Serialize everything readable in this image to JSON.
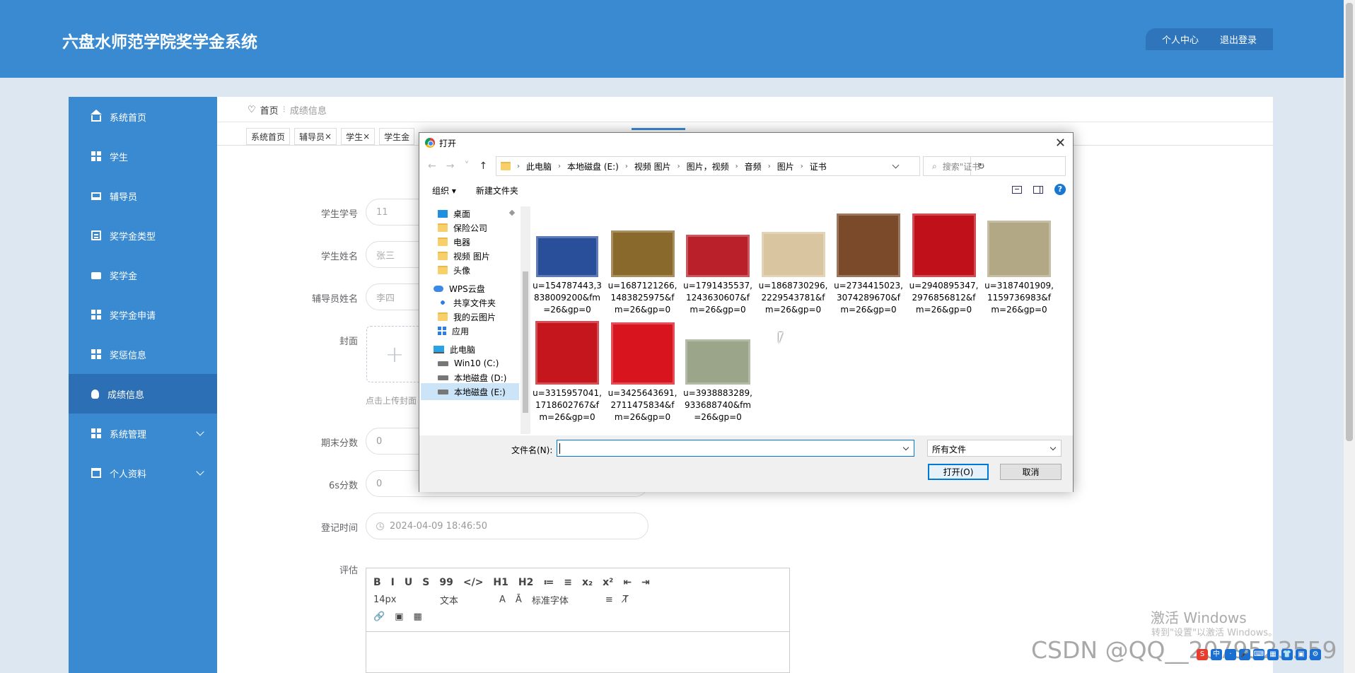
{
  "header": {
    "title": "六盘水师范学院奖学金系统",
    "profile_label": "个人中心",
    "logout_label": "退出登录"
  },
  "sidebar": {
    "items": [
      {
        "label": "系统首页",
        "icon": "home-icon"
      },
      {
        "label": "学生",
        "icon": "grid-icon"
      },
      {
        "label": "辅导员",
        "icon": "monitor-icon"
      },
      {
        "label": "奖学金类型",
        "icon": "clipboard-icon"
      },
      {
        "label": "奖学金",
        "icon": "card-icon"
      },
      {
        "label": "奖学金申请",
        "icon": "grid-icon"
      },
      {
        "label": "奖惩信息",
        "icon": "grid-icon"
      },
      {
        "label": "成绩信息",
        "icon": "bulb-icon",
        "active": true
      },
      {
        "label": "系统管理",
        "icon": "grid-icon"
      },
      {
        "label": "个人资料",
        "icon": "calendar-icon"
      }
    ]
  },
  "breadcrumb": {
    "home": "首页",
    "current": "成绩信息"
  },
  "tabs": [
    {
      "label": "系统首页"
    },
    {
      "label": "辅导员",
      "close": "×"
    },
    {
      "label": "学生",
      "close": "×"
    },
    {
      "label": "学生金"
    }
  ],
  "form": {
    "student_no_label": "学生学号",
    "student_no_value": "11",
    "student_name_label": "学生姓名",
    "student_name_value": "张三",
    "counselor_label": "辅导员姓名",
    "counselor_value": "李四",
    "cover_label": "封面",
    "cover_tip": "点击上传封面",
    "final_score_label": "期末分数",
    "final_score_value": "0",
    "s6_score_label": "6s分数",
    "s6_score_value": "0",
    "register_time_label": "登记时间",
    "register_time_value": "2024-04-09 18:46:50",
    "review_label": "评估"
  },
  "editor": {
    "row1": [
      "B",
      "I",
      "U",
      "S",
      "99",
      "</>",
      "H1",
      "H2",
      "≔",
      "≡",
      "x₂",
      "x²",
      "⇤",
      "⇥"
    ],
    "font_size": "14px",
    "text_type": "文本",
    "font_family": "标准字体",
    "row3": [
      "🔗",
      "▣",
      "▦"
    ]
  },
  "dialog": {
    "title": "打开",
    "path": [
      "此电脑",
      "本地磁盘 (E:)",
      "视频 图片",
      "图片，视频",
      "音频",
      "图片",
      "证书"
    ],
    "search_placeholder": "搜索\"证书\"",
    "organize_label": "组织 ▾",
    "new_folder_label": "新建文件夹",
    "tree": [
      {
        "label": "桌面",
        "icon": "desktop-icon"
      },
      {
        "label": "保险公司",
        "icon": "folder-icon"
      },
      {
        "label": "电器",
        "icon": "folder-icon"
      },
      {
        "label": "视频 图片",
        "icon": "folder-icon"
      },
      {
        "label": "头像",
        "icon": "folder-icon"
      },
      {
        "label": "WPS云盘",
        "icon": "cloud-icon"
      },
      {
        "label": "共享文件夹",
        "icon": "share-icon"
      },
      {
        "label": "我的云图片",
        "icon": "folder-icon"
      },
      {
        "label": "应用",
        "icon": "apps-icon"
      },
      {
        "label": "此电脑",
        "icon": "pc-icon"
      },
      {
        "label": "Win10 (C:)",
        "icon": "drive-icon"
      },
      {
        "label": "本地磁盘 (D:)",
        "icon": "drive-icon"
      },
      {
        "label": "本地磁盘 (E:)",
        "icon": "drive-icon",
        "selected": true
      }
    ],
    "files": [
      {
        "name": "u=154787443,3838009200&fm=26&gp=0",
        "line1": "u=154787443,3",
        "line2": "838009200&fm",
        "line3": "=26&gp=0",
        "color": "#2a4f9a"
      },
      {
        "name": "u=1687121266,1483825975&fm=26&gp=0",
        "line1": "u=1687121266,",
        "line2": "1483825975&f",
        "line3": "m=26&gp=0",
        "color": "#8a6a2c"
      },
      {
        "name": "u=1791435537,1243630607&fm=26&gp=0",
        "line1": "u=1791435537,",
        "line2": "1243630607&f",
        "line3": "m=26&gp=0",
        "color": "#b9202a"
      },
      {
        "name": "u=1868730296,2229543781&fm=26&gp=0",
        "line1": "u=1868730296,",
        "line2": "2229543781&f",
        "line3": "m=26&gp=0",
        "color": "#d9c6a0"
      },
      {
        "name": "u=2734415023,3074289670&fm=26&gp=0",
        "line1": "u=2734415023,",
        "line2": "3074289670&f",
        "line3": "m=26&gp=0",
        "color": "#7a4a2a"
      },
      {
        "name": "u=2940895347,2976856812&fm=26&gp=0",
        "line1": "u=2940895347,",
        "line2": "2976856812&f",
        "line3": "m=26&gp=0",
        "color": "#c0101a"
      },
      {
        "name": "u=3187401909,1159736983&fm=26&gp=0",
        "line1": "u=3187401909,",
        "line2": "1159736983&f",
        "line3": "m=26&gp=0",
        "color": "#b3a886"
      },
      {
        "name": "u=3315957041,1718602767&fm=26&gp=0",
        "line1": "u=3315957041,",
        "line2": "1718602767&f",
        "line3": "m=26&gp=0",
        "color": "#c4161c"
      },
      {
        "name": "u=3425643691,2711475834&fm=26&gp=0",
        "line1": "u=3425643691,",
        "line2": "2711475834&f",
        "line3": "m=26&gp=0",
        "color": "#d8141f"
      },
      {
        "name": "u=3938883289,933688740&fm=26&gp=0",
        "line1": "u=3938883289,",
        "line2": "933688740&fm",
        "line3": "=26&gp=0",
        "color": "#9aa58a"
      }
    ],
    "filename_label": "文件名(N):",
    "filename_value": "",
    "filetype_value": "所有文件",
    "open_label": "打开(O)",
    "cancel_label": "取消"
  },
  "watermark": {
    "line1": "激活 Windows",
    "line2": "转到\"设置\"以激活 Windows。",
    "csdn": "CSDN @QQ__2079523559"
  },
  "tray": [
    "S",
    "中",
    "·",
    "🎤",
    "⌨",
    "▦",
    "👕",
    "▣",
    "⚙"
  ],
  "colors": {
    "primary": "#3a8ad2",
    "sidebar_active": "#2d6fb5",
    "dialog_accent": "#0078d7"
  }
}
